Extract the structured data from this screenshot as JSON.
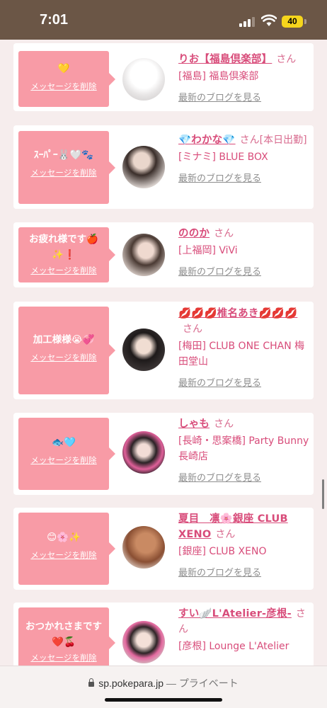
{
  "status": {
    "time": "7:01",
    "battery": "40"
  },
  "common": {
    "delete_label": "メッセージを削除",
    "blog_label": "最新のブログを見る",
    "san": "さん"
  },
  "items": [
    {
      "message": "💛",
      "name": "りお【福島倶楽部】",
      "shop": "[福島] 福島倶楽部"
    },
    {
      "message": "ｽｰﾊﾟｰ🐰🤍🐾",
      "name": "💎わかな💎",
      "shop": "[ミナミ] BLUE BOX"
    },
    {
      "message": "お疲れ様です🍎✨❗",
      "name": "ののか",
      "shop": "[上福岡] ViVi"
    },
    {
      "message": "加工様様😭💞",
      "name": "💋💋💋椎名あき💋💋💋",
      "shop": "[梅田] CLUB ONE CHAN 梅田堂山"
    },
    {
      "message": "🐟🩵",
      "name": "しゃも",
      "shop": "[長崎・思案橋] Party Bunny 長崎店"
    },
    {
      "message": "😊🌸✨",
      "name": "夏目　凛🌸銀座 CLUB XENO",
      "shop": "[銀座] CLUB XENO"
    },
    {
      "message": "おつかれさまです❤️🍒",
      "name": "すい🪽L'Atelier-彦根-",
      "shop": "[彦根] Lounge L'Atelier"
    }
  ],
  "url_bar": {
    "domain": "sp.pokepara.jp",
    "separator": "—",
    "mode": "プライベート"
  }
}
